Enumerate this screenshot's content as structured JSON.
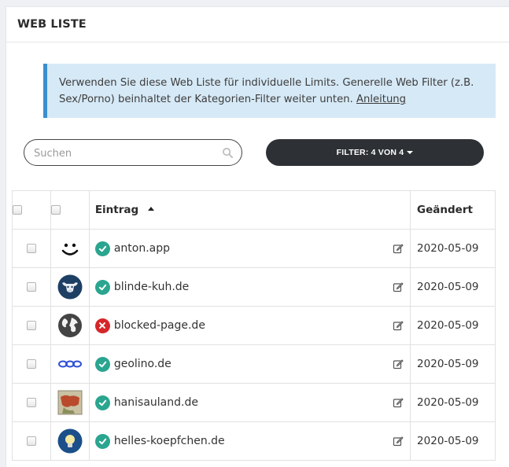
{
  "panel": {
    "title": "WEB LISTE"
  },
  "info": {
    "text": "Verwenden Sie diese Web Liste für individuelle Limits. Generelle Web Filter (z.B. Sex/Porno) beinhaltet der Kategorien-Filter weiter unten. ",
    "link_label": "Anleitung"
  },
  "search": {
    "placeholder": "Suchen",
    "value": "",
    "icon": "search-icon"
  },
  "filter": {
    "label": "FILTER: 4 VON 4"
  },
  "table": {
    "columns": {
      "entry": "Eintrag",
      "changed": "Geändert"
    },
    "rows": [
      {
        "logo": "smiley-logo",
        "status": "allowed",
        "domain": "anton.app",
        "changed": "2020-05-09"
      },
      {
        "logo": "cow-logo",
        "status": "allowed",
        "domain": "blinde-kuh.de",
        "changed": "2020-05-09"
      },
      {
        "logo": "globe-logo",
        "status": "blocked",
        "domain": "blocked-page.de",
        "changed": "2020-05-09"
      },
      {
        "logo": "chain-logo",
        "status": "allowed",
        "domain": "geolino.de",
        "changed": "2020-05-09"
      },
      {
        "logo": "map-logo",
        "status": "allowed",
        "domain": "hanisauland.de",
        "changed": "2020-05-09"
      },
      {
        "logo": "bulb-logo",
        "status": "allowed",
        "domain": "helles-koepfchen.de",
        "changed": "2020-05-09"
      }
    ]
  },
  "colors": {
    "allowed": "#2aa58f",
    "blocked": "#d6262a",
    "info_bg": "#d6e9f6",
    "info_border": "#3a8fd0",
    "button_dark": "#2d3035"
  }
}
